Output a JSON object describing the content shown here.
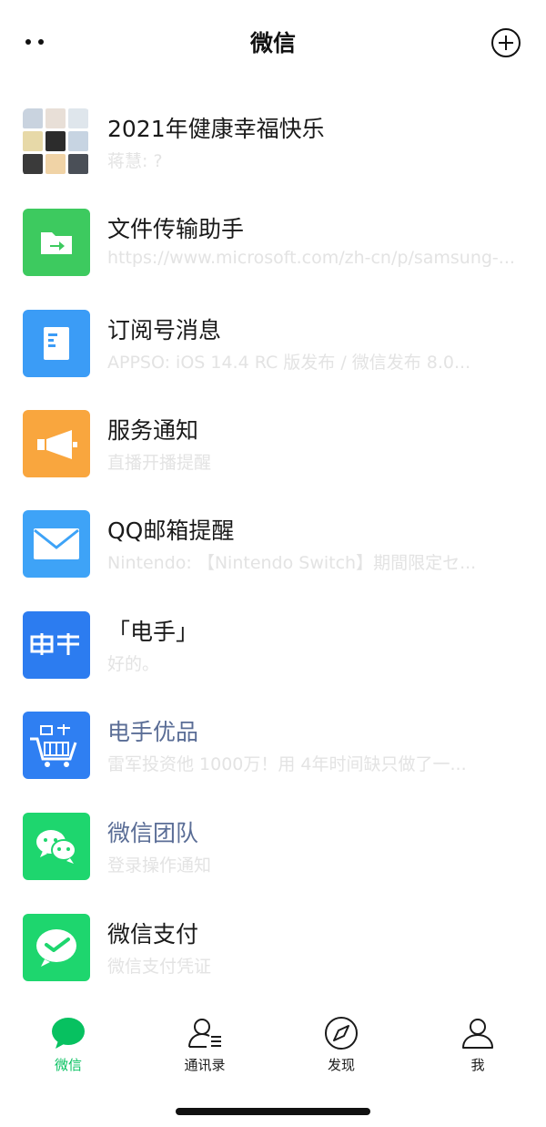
{
  "header": {
    "title": "微信"
  },
  "chats": [
    {
      "name": "2021年健康幸福快乐",
      "preview": "蒋慧: ?",
      "avatar": "group-avatar",
      "official": false
    },
    {
      "name": "文件传输助手",
      "preview": "https://www.microsoft.com/zh-cn/p/samsung-...",
      "avatar": "folder-icon",
      "color": "#3dca5f",
      "official": false
    },
    {
      "name": "订阅号消息",
      "preview": "APPSO: iOS 14.4 RC 版发布 / 微信发布 8.0...",
      "avatar": "article-icon",
      "color": "#3b9cf6",
      "official": false
    },
    {
      "name": "服务通知",
      "preview": "直播开播提醒",
      "avatar": "megaphone-icon",
      "color": "#f9a63e",
      "official": false
    },
    {
      "name": "QQ邮箱提醒",
      "preview": "Nintendo: 【Nintendo Switch】期間限定セ...",
      "avatar": "mail-icon",
      "color": "#3ea3f7",
      "official": false
    },
    {
      "name": "「电手」",
      "preview": "好的。",
      "avatar": "dianshou-logo",
      "color": "#2c7cf0",
      "official": false
    },
    {
      "name": "电手优品",
      "preview": "雷军投资他 1000万！用 4年时间缺只做了一...",
      "avatar": "dianshou-cart-logo",
      "color": "#2f7ff2",
      "official": true
    },
    {
      "name": "微信团队",
      "preview": "登录操作通知",
      "avatar": "wechat-logo",
      "color": "#1ed66e",
      "official": true
    },
    {
      "name": "微信支付",
      "preview": "微信支付凭证",
      "avatar": "wechat-pay-logo",
      "color": "#1ed66e",
      "official": false
    }
  ],
  "tabs": [
    {
      "label": "微信",
      "icon": "chat-bubble-icon",
      "active": true
    },
    {
      "label": "通讯录",
      "icon": "contacts-icon",
      "active": false
    },
    {
      "label": "发现",
      "icon": "compass-icon",
      "active": false
    },
    {
      "label": "我",
      "icon": "person-icon",
      "active": false
    }
  ],
  "colors": {
    "accent": "#07c160",
    "official_name": "#5a6d96",
    "preview_text": "#e3e3e3"
  }
}
